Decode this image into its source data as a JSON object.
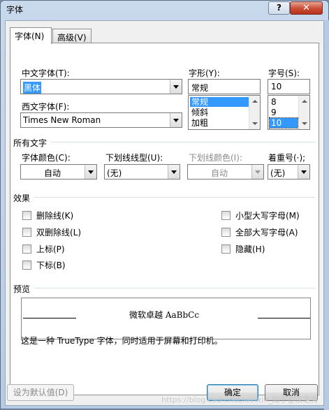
{
  "window": {
    "title": "字体",
    "help_label": "?",
    "close_label": "✕"
  },
  "tabs": [
    {
      "label": "字体(N)",
      "active": true
    },
    {
      "label": "高级(V)",
      "active": false
    }
  ],
  "font": {
    "chinese_label": "中文字体(T):",
    "chinese_value": "黑体",
    "western_label": "西文字体(F):",
    "western_value": "Times New Roman",
    "style_label": "字形(Y):",
    "style_value": "常规",
    "style_options": [
      "常规",
      "倾斜",
      "加粗"
    ],
    "size_label": "字号(S):",
    "size_value": "10",
    "size_options": [
      "8",
      "9",
      "10"
    ]
  },
  "all_text": {
    "section_label": "所有文字",
    "font_color_label": "字体颜色(C):",
    "font_color_value": "自动",
    "underline_type_label": "下划线线型(U):",
    "underline_type_value": "(无)",
    "underline_color_label": "下划线颜色(I):",
    "underline_color_value": "自动",
    "emphasis_label": "着重号(·);",
    "emphasis_value": "(无)"
  },
  "effects": {
    "section_label": "效果",
    "left": [
      {
        "label": "删除线(K)",
        "checked": false
      },
      {
        "label": "双删除线(L)",
        "checked": false
      },
      {
        "label": "上标(P)",
        "checked": false
      },
      {
        "label": "下标(B)",
        "checked": false
      }
    ],
    "right": [
      {
        "label": "小型大写字母(M)",
        "checked": false
      },
      {
        "label": "全部大写字母(A)",
        "checked": false
      },
      {
        "label": "隐藏(H)",
        "checked": false
      }
    ]
  },
  "preview": {
    "section_label": "预览",
    "sample_text": "微软卓越 AaBbCc",
    "description": "这是一种 TrueType 字体，同时适用于屏幕和打印机。"
  },
  "buttons": {
    "set_default": "设为默认值(D)",
    "ok": "确定",
    "cancel": "取消"
  },
  "watermark": "https://blog.csdn.net/weixin_知乎@汉语秀"
}
